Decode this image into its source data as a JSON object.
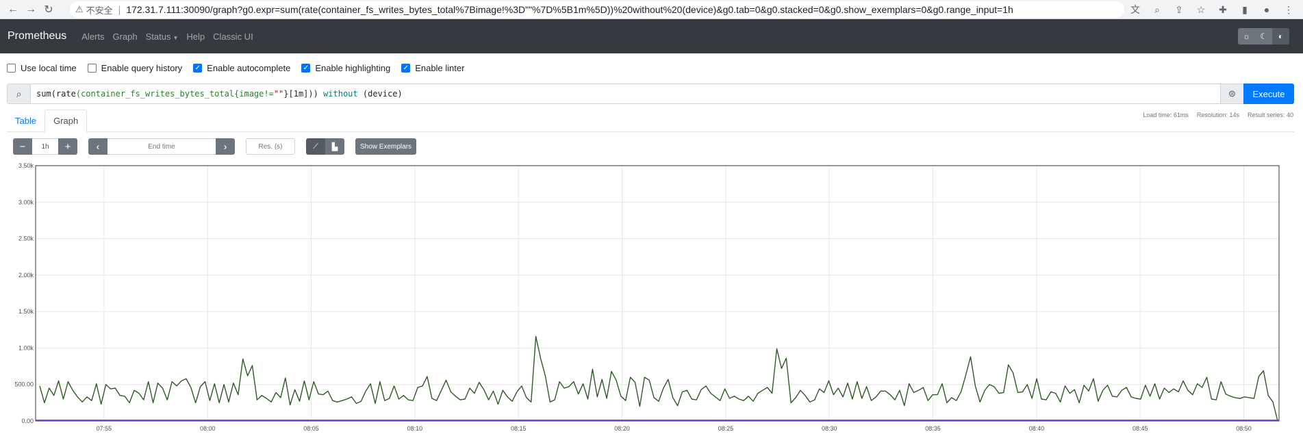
{
  "browser": {
    "security_label": "不安全",
    "url": "172.31.7.111:30090/graph?g0.expr=sum(rate(container_fs_writes_bytes_total%7Bimage!%3D\"\"%7D%5B1m%5D))%20without%20(device)&g0.tab=0&g0.stacked=0&g0.show_exemplars=0&g0.range_input=1h"
  },
  "navbar": {
    "brand": "Prometheus",
    "links": [
      "Alerts",
      "Graph",
      "Status",
      "Help",
      "Classic UI"
    ]
  },
  "options": {
    "use_local_time": "Use local time",
    "query_history": "Enable query history",
    "autocomplete": "Enable autocomplete",
    "highlighting": "Enable highlighting",
    "linter": "Enable linter",
    "checked": [
      false,
      false,
      true,
      true,
      true
    ]
  },
  "expression": {
    "p1": "sum",
    "p2": "(",
    "p3": "rate",
    "p4": "(container_fs_writes_bytes_total{image!=",
    "p5": "\"\"",
    "p6": "}[1m])) ",
    "p7": "without",
    "p8": " (device)",
    "execute_label": "Execute"
  },
  "tabs": {
    "table": "Table",
    "graph": "Graph"
  },
  "stats": {
    "load_time": "Load time: 61ms",
    "resolution": "Resolution: 14s",
    "result_series": "Result series: 40"
  },
  "controls": {
    "range": "1h",
    "end_time_placeholder": "End time",
    "res_placeholder": "Res. (s)",
    "show_exemplars": "Show Exemplars"
  },
  "colors": {
    "line": "#2d5a24",
    "baseline": "#7b3fbf",
    "grid": "#e6e6e6"
  },
  "chart_data": {
    "type": "line",
    "y_ticks": [
      "0.00",
      "500.00",
      "1.00k",
      "1.50k",
      "2.00k",
      "2.50k",
      "3.00k",
      "3.50k"
    ],
    "ylim": [
      0,
      3500
    ],
    "x_ticks": [
      "07:55",
      "08:00",
      "08:05",
      "08:10",
      "08:15",
      "08:20",
      "08:25",
      "08:30",
      "08:35",
      "08:40",
      "08:45",
      "08:50"
    ],
    "xlim_minutes": [
      -3.3,
      56.7
    ],
    "series": [
      {
        "values": [
          480,
          250,
          450,
          350,
          550,
          300,
          540,
          420,
          330,
          260,
          330,
          280,
          510,
          230,
          500,
          440,
          450,
          350,
          340,
          250,
          420,
          380,
          290,
          540,
          250,
          520,
          450,
          290,
          540,
          480,
          550,
          580,
          460,
          250,
          470,
          540,
          280,
          510,
          250,
          500,
          260,
          520,
          360,
          850,
          620,
          760,
          290,
          350,
          310,
          260,
          390,
          320,
          590,
          220,
          430,
          270,
          550,
          290,
          540,
          370,
          360,
          410,
          280,
          260,
          280,
          300,
          330,
          240,
          270,
          410,
          510,
          240,
          540,
          280,
          310,
          480,
          300,
          350,
          290,
          280,
          460,
          480,
          610,
          310,
          280,
          420,
          560,
          400,
          340,
          290,
          300,
          450,
          380,
          530,
          430,
          290,
          410,
          230,
          420,
          330,
          270,
          400,
          480,
          320,
          260,
          1160,
          860,
          620,
          260,
          290,
          540,
          450,
          470,
          540,
          370,
          510,
          300,
          710,
          330,
          570,
          310,
          680,
          560,
          340,
          280,
          600,
          530,
          200,
          600,
          560,
          320,
          270,
          450,
          570,
          320,
          210,
          400,
          420,
          300,
          290,
          430,
          480,
          380,
          330,
          280,
          440,
          310,
          340,
          300,
          280,
          340,
          270,
          380,
          420,
          460,
          380,
          990,
          720,
          860,
          250,
          320,
          420,
          350,
          260,
          290,
          440,
          390,
          550,
          360,
          450,
          330,
          520,
          300,
          540,
          310,
          470,
          280,
          330,
          410,
          410,
          360,
          290,
          420,
          210,
          510,
          390,
          420,
          460,
          280,
          360,
          360,
          510,
          250,
          320,
          280,
          400,
          630,
          880,
          480,
          260,
          420,
          500,
          470,
          380,
          390,
          770,
          660,
          390,
          400,
          500,
          310,
          580,
          300,
          290,
          400,
          380,
          260,
          480,
          380,
          430,
          250,
          490,
          410,
          580,
          270,
          420,
          490,
          340,
          330,
          420,
          460,
          330,
          310,
          300,
          490,
          340,
          510,
          300,
          450,
          390,
          440,
          400,
          550,
          420,
          360,
          510,
          460,
          600,
          300,
          290,
          540,
          370,
          340,
          320,
          310,
          330,
          320,
          310,
          610,
          690,
          350,
          260,
          0
        ]
      }
    ]
  }
}
